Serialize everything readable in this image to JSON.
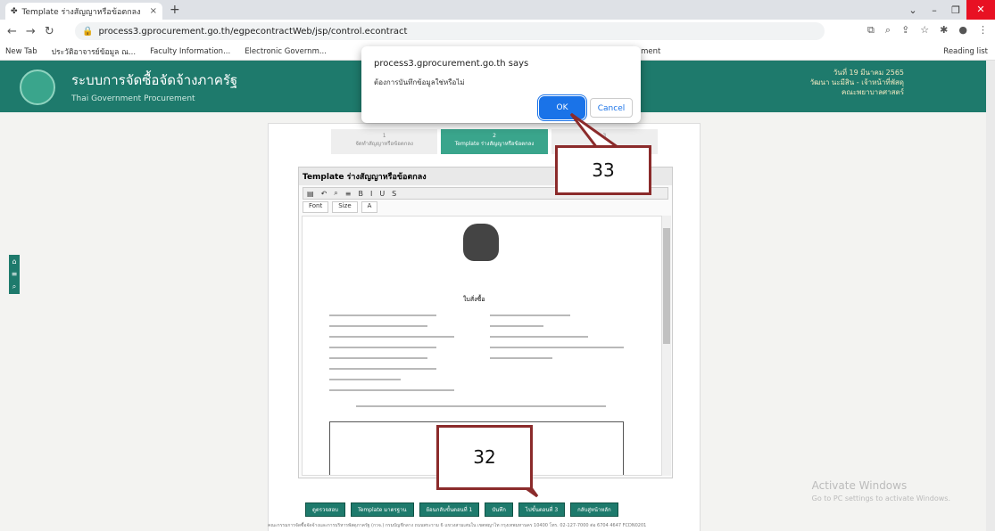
{
  "browser": {
    "tab_title": "Template ร่างสัญญาหรือข้อตกลง",
    "url": "process3.gprocurement.go.th/egpecontractWeb/jsp/control.econtract",
    "bookmarks": [
      "New Tab",
      "ประวัติอาจารย์ข้อมูล ณ...",
      "Faculty Information...",
      "Electronic Governm...",
      "...ment"
    ],
    "reading_list": "Reading list"
  },
  "site": {
    "title": "ระบบการจัดซื้อจัดจ้างภาครัฐ",
    "subtitle": "Thai Government Procurement",
    "user_lines": [
      "วันที่ 19 มีนาคม 2565",
      "วัฒนา นะมีสิน - เจ้าหน้าที่พัสดุ",
      "คณะพยาบาลศาสตร์"
    ]
  },
  "steps": [
    {
      "num": "1",
      "label": "จัดทำสัญญาหรือข้อตกลง"
    },
    {
      "num": "2",
      "label": "Template ร่างสัญญาหรือข้อตกลง"
    },
    {
      "num": "3",
      "label": ""
    }
  ],
  "editor": {
    "title": "Template ร่างสัญญาหรือข้อตกลง",
    "font": "Font",
    "size": "Size",
    "doc_heading": "ใบสั่งซื้อ"
  },
  "buttons": [
    "ดูตรวจสอบ",
    "Template มาตรฐาน",
    "ย้อนกลับขั้นตอนที่ 1",
    "บันทึก",
    "ไปขั้นตอนที่ 3",
    "กลับสู่หน้าหลัก"
  ],
  "footer": "คณะกรรมการจัดซื้อจัดจ้างและการบริหารพัสดุภาครัฐ (กวจ.) กรมบัญชีกลาง ถนนพระราม 6 แขวงสามเสนใน เขตพญาไท กรุงเทพมหานคร 10400 โทร. 02-127-7000 ต่อ 6704 4647",
  "footer_code": "FCDN0201",
  "dialog": {
    "origin": "process3.gprocurement.go.th says",
    "message": "ต้องการบันทึกข้อมูลใช่หรือไม่",
    "ok": "OK",
    "cancel": "Cancel"
  },
  "callouts": {
    "a": "33",
    "b": "32"
  },
  "windows": {
    "line1": "Activate Windows",
    "line2": "Go to PC settings to activate Windows."
  }
}
